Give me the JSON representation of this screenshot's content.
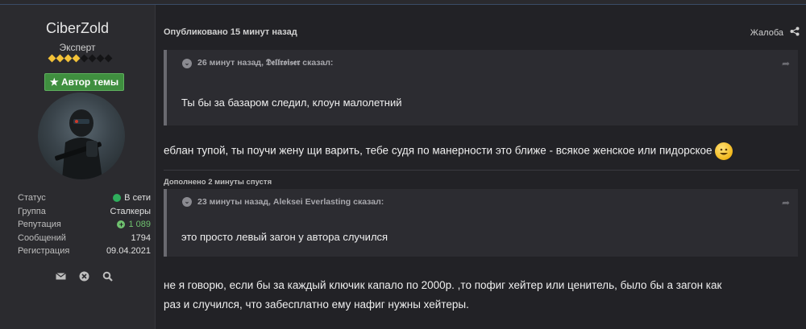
{
  "author": {
    "name": "CiberZold",
    "title": "Эксперт",
    "badge": "Автор темы",
    "rank_filled": 4,
    "rank_total": 8,
    "stats": [
      {
        "label": "Статус",
        "value": "В сети"
      },
      {
        "label": "Группа",
        "value": "Сталкеры"
      },
      {
        "label": "Репутация",
        "value": "1 089"
      },
      {
        "label": "Сообщений",
        "value": "1794"
      },
      {
        "label": "Регистрация",
        "value": "09.04.2021"
      }
    ],
    "icons": [
      "envelope-icon",
      "close-icon",
      "search-icon"
    ]
  },
  "post": {
    "published": "Опубликовано 15 минут назад",
    "report": "Жалоба",
    "quote1": {
      "head": "26 минут назад, 𝕯𝖊𝖑𝖑𝖗𝖔𝖎𝖘𝖊𝖗 сказал:",
      "body": "Ты бы за базаром следил,  клоун малолетний"
    },
    "reply1": "еблан тупой, ты поучи жену щи варить, тебе судя по манерности это ближе - всякое женское или пидорское",
    "added": "Дополнено 2 минуты спустя",
    "quote2": {
      "head": "23 минуты назад, Aleksei Everlasting сказал:",
      "body": "это просто левый загон у автора случился"
    },
    "reply2_line1": "не я говорю, если бы за каждый ключик капало по 2000р. ,то пофиг хейтер или ценитель, было бы а загон как",
    "reply2_line2": "раз и случился, что забесплатно ему нафиг нужны хейтеры."
  },
  "colors": {
    "accent_green": "#3f8f3f",
    "rank_gold": "#f3c238",
    "online": "#2fae5c"
  }
}
